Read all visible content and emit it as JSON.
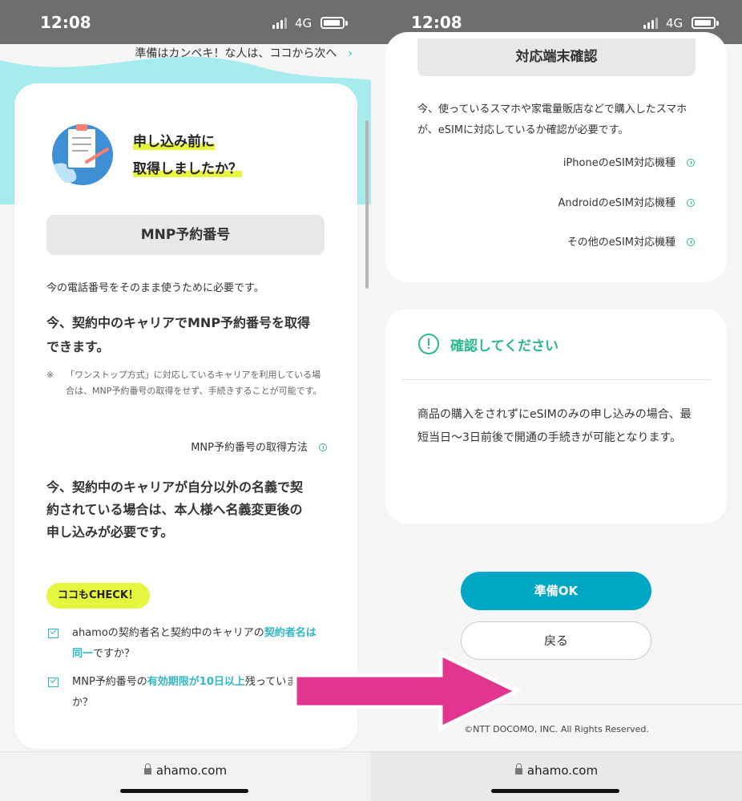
{
  "status": {
    "time": "12:08",
    "network": "4G"
  },
  "browser": {
    "url": "ahamo.com"
  },
  "left": {
    "next_link": "準備はカンペキ！な人は、ココから次へ",
    "heading_line1": "申し込み前に",
    "heading_line2": "取得しましたか？",
    "section_title": "MNP予約番号",
    "intro": "今の電話番号をそのまま使うために必要です。",
    "bold1_line1": "今、契約中のキャリアでMNP予約番号を取得",
    "bold1_line2": "できます。",
    "note_mark": "※",
    "note_body": "「ワンストップ方式」に対応しているキャリアを利用している場合は、MNP予約番号の取得をせず、手続きすることが可能です。",
    "howto_link": "MNP予約番号の取得方法",
    "bold2_line1": "今、契約中のキャリアが自分以外の名義で契",
    "bold2_line2": "約されている場合は、本人様へ名義変更後の",
    "bold2_line3": "申し込みが必要です。",
    "check_label": "ココもCHECK！",
    "check1_a": "ahamoの契約者名と契約中のキャリアの",
    "check1_hl": "契約者名は同一",
    "check1_b": "ですか？",
    "check2_a": "MNP予約番号の",
    "check2_hl": "有効期限が10日以上",
    "check2_b": "残っていますか？"
  },
  "right": {
    "section_title": "対応端末確認",
    "desc": "今、使っているスマホや家電量販店などで購入したスマホが、eSIMに対応しているか確認が必要です。",
    "links": [
      "iPhoneのeSIM対応機種",
      "AndroidのeSIM対応機種",
      "その他のeSIM対応機種"
    ],
    "confirm_title": "確認してください",
    "confirm_body": "商品の購入をされずにeSIMのみの申し込みの場合、最短当日〜3日前後で開通の手続きが可能となります。",
    "ok_button": "準備OK",
    "back_button": "戻る",
    "copyright": "©NTT DOCOMO, INC. All Rights Reserved."
  },
  "colors": {
    "accent": "#00a7c5",
    "green": "#2cb88e",
    "highlight": "#e6f53d",
    "arrow": "#e2358f"
  },
  "icons": [
    "checklist-illustration",
    "info-icon",
    "alert-circle-icon",
    "check-icon",
    "lock-icon",
    "big-arrow-right"
  ]
}
